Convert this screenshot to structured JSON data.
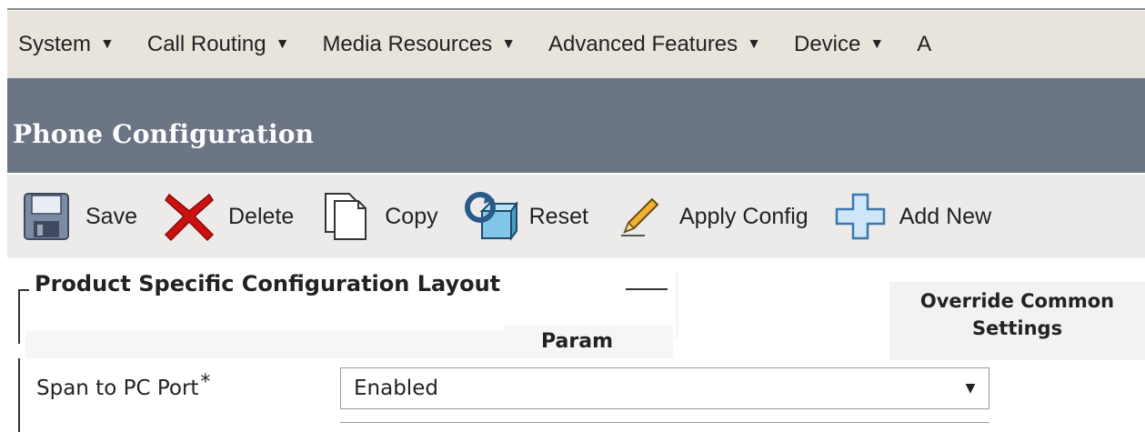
{
  "menu": {
    "items": [
      {
        "label": "System"
      },
      {
        "label": "Call Routing"
      },
      {
        "label": "Media Resources"
      },
      {
        "label": "Advanced Features"
      },
      {
        "label": "Device"
      },
      {
        "label": "A"
      }
    ],
    "caret": "▼"
  },
  "page": {
    "title": "Phone Configuration"
  },
  "toolbar": {
    "save_label": "Save",
    "delete_label": "Delete",
    "copy_label": "Copy",
    "reset_label": "Reset",
    "apply_config_label": "Apply Config",
    "add_new_label": "Add New"
  },
  "section": {
    "legend": "Product Specific Configuration Layout",
    "param_header": "Param",
    "override_header_line1": "Override Common",
    "override_header_line2": "Settings"
  },
  "fields": {
    "span_to_pc_port": {
      "label": "Span to PC Port",
      "required_mark": "*",
      "value": "Enabled"
    }
  },
  "colors": {
    "title_bar": "#6b7584",
    "menu_bar": "#e8e4dc",
    "toolbar": "#ecebe9",
    "delete_red": "#cc1111"
  }
}
